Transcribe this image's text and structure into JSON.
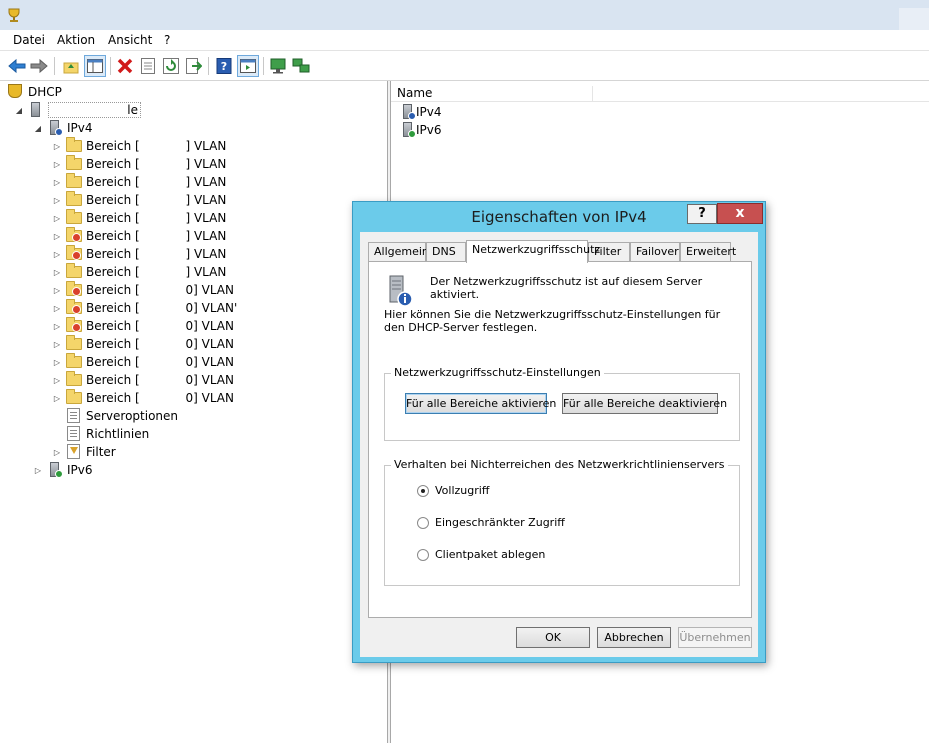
{
  "menu": [
    "Datei",
    "Aktion",
    "Ansicht",
    "?"
  ],
  "tree": {
    "root_label": "DHCP",
    "server_label": "                    le",
    "ipv4_label": "IPv4",
    "scopes": [
      {
        "label": "Bereich [            ] VLAN",
        "warn": false
      },
      {
        "label": "Bereich [            ] VLAN",
        "warn": false
      },
      {
        "label": "Bereich [            ] VLAN",
        "warn": false
      },
      {
        "label": "Bereich [            ] VLAN",
        "warn": false
      },
      {
        "label": "Bereich [            ] VLAN",
        "warn": false
      },
      {
        "label": "Bereich [            ] VLAN",
        "warn": true
      },
      {
        "label": "Bereich [            ] VLAN",
        "warn": true
      },
      {
        "label": "Bereich [            ] VLAN",
        "warn": false
      },
      {
        "label": "Bereich [            0] VLAN",
        "warn": true
      },
      {
        "label": "Bereich [            0] VLAN'",
        "warn": true
      },
      {
        "label": "Bereich [            0] VLAN",
        "warn": true
      },
      {
        "label": "Bereich [            0] VLAN",
        "warn": false
      },
      {
        "label": "Bereich [            0] VLAN",
        "warn": false
      },
      {
        "label": "Bereich [            0] VLAN",
        "warn": false
      },
      {
        "label": "Bereich [            0] VLAN",
        "warn": false
      }
    ],
    "serveroptionen_label": "Serveroptionen",
    "richtlinien_label": "Richtlinien",
    "filter_label": "Filter",
    "ipv6_label": "IPv6"
  },
  "rightpane": {
    "column_name": "Name",
    "items": [
      "IPv4",
      "IPv6"
    ]
  },
  "dialog": {
    "title": "Eigenschaften von IPv4",
    "help_label": "?",
    "close_label": "x",
    "tabs": [
      "Allgemein",
      "DNS",
      "Netzwerkzugriffsschutz",
      "Filter",
      "Failover",
      "Erweitert"
    ],
    "selected_tab": "Netzwerkzugriffsschutz",
    "status_text": "Der Netzwerkzugriffsschutz ist auf diesem Server aktiviert.",
    "description": "Hier können Sie die Netzwerkzugriffsschutz-Einstellungen für den DHCP-Server festlegen.",
    "group1_label": "Netzwerkzugriffsschutz-Einstellungen",
    "enable_all_label": "Für alle Bereiche aktivieren",
    "disable_all_label": "Für alle Bereiche deaktivieren",
    "group2_label": "Verhalten bei Nichterreichen des Netzwerkrichtlinienservers",
    "radio_full": "Vollzugriff",
    "radio_restricted": "Eingeschränkter Zugriff",
    "radio_drop": "Clientpaket ablegen",
    "selected_radio": "Vollzugriff",
    "ok_label": "OK",
    "cancel_label": "Abbrechen",
    "apply_label": "Übernehmen"
  },
  "colors": {
    "dialog_frame": "#6bcbea",
    "close_button": "#c75050",
    "titlebar": "#d9e4f1"
  }
}
